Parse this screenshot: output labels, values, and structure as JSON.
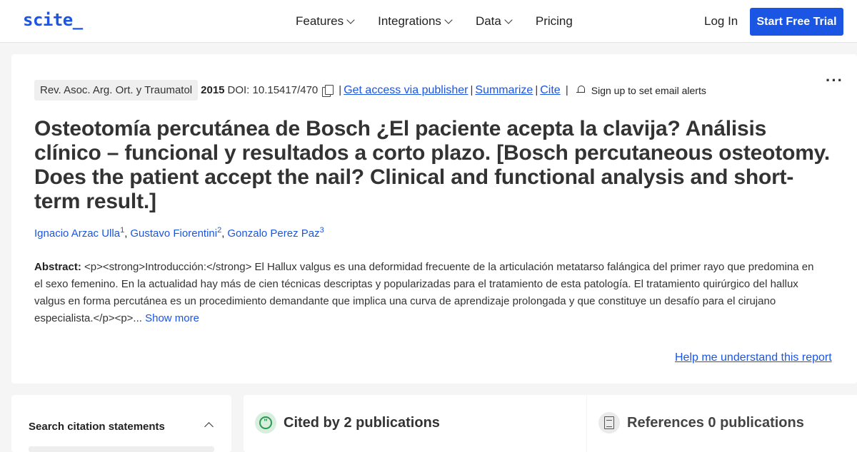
{
  "header": {
    "logo": "scite_",
    "nav": [
      "Features",
      "Integrations",
      "Data",
      "Pricing"
    ],
    "login": "Log In",
    "trial": "Start Free Trial"
  },
  "article": {
    "journal": "Rev. Asoc. Arg. Ort. y Traumatol",
    "year": "2015",
    "doi": "DOI: 10.15417/470",
    "links": {
      "access": "Get access via publisher",
      "summarize": "Summarize",
      "cite": "Cite"
    },
    "alerts": "Sign up to set email alerts",
    "title": "Osteotomía percutánea de Bosch ¿El paciente acepta la clavija? Análisis clínico – funcional y resultados a corto plazo. [Bosch percutaneous osteotomy. Does the patient accept the nail? Clinical and functional analysis and short-term result.]",
    "authors": [
      {
        "name": "Ignacio Arzac Ulla",
        "sup": "1"
      },
      {
        "name": "Gustavo Fiorentini",
        "sup": "2"
      },
      {
        "name": "Gonzalo Perez Paz",
        "sup": "3"
      }
    ],
    "abstract_label": "Abstract:",
    "abstract_text": "<p><strong>Introducción:</strong> El Hallux valgus es una deformidad frecuente de la articulación metatarso falángica del primer rayo que predomina en el sexo femenino. En la actualidad hay más de cien técnicas descriptas y popularizadas para el tratamiento de esta patología. El tratamiento quirúrgico del hallux valgus en forma percutánea es un procedimiento demandante que implica una curva de aprendizaje prolongada y que constituye un desafío para el cirujano especialista.</p><p>...",
    "show_more": "Show more",
    "help": "Help me understand this report"
  },
  "panels": {
    "search": "Search citation statements",
    "cited_by": "Cited by 2 publications",
    "references": "References 0 publications"
  }
}
